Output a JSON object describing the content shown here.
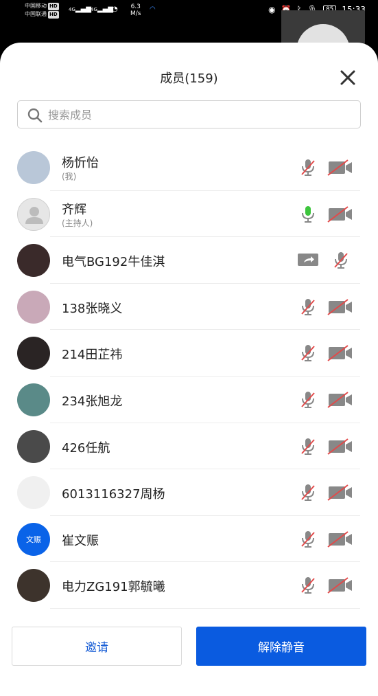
{
  "status_bar": {
    "carrier1": "中国移动",
    "carrier2": "中国联通",
    "hd": "HD",
    "net1": "4G",
    "net2": "4G",
    "speed_value": "6.3",
    "speed_unit": "M/s",
    "battery": "85",
    "time": "15:33"
  },
  "sheet": {
    "title": "成员(159)",
    "search_placeholder": "搜索成员"
  },
  "members": [
    {
      "name": "杨忻怡",
      "sub": "(我)",
      "avatar_color": "#b9c7d8",
      "mic_on": false,
      "screen_share": false
    },
    {
      "name": "齐辉",
      "sub": "(主持人)",
      "avatar_color": "#e6e6e6",
      "mic_on": true,
      "screen_share": false
    },
    {
      "name": "电气BG192牛佳淇",
      "sub": "",
      "avatar_color": "#3a2a2a",
      "mic_on": false,
      "screen_share": true
    },
    {
      "name": "138张晓义",
      "sub": "",
      "avatar_color": "#c9a9b8",
      "mic_on": false,
      "screen_share": false
    },
    {
      "name": "214田芷祎",
      "sub": "",
      "avatar_color": "#2a2424",
      "mic_on": false,
      "screen_share": false
    },
    {
      "name": "234张旭龙",
      "sub": "",
      "avatar_color": "#5a8a88",
      "mic_on": false,
      "screen_share": false
    },
    {
      "name": "426任航",
      "sub": "",
      "avatar_color": "#4a4a4a",
      "mic_on": false,
      "screen_share": false
    },
    {
      "name": "6013116327周杨",
      "sub": "",
      "avatar_color": "#f0f0f0",
      "mic_on": false,
      "screen_share": false
    },
    {
      "name": "崔文赈",
      "sub": "",
      "avatar_color": "#0a63e8",
      "avatar_text": "文赈",
      "mic_on": false,
      "screen_share": false
    },
    {
      "name": "电力ZG191郭毓曦",
      "sub": "",
      "avatar_color": "#3d332c",
      "mic_on": false,
      "screen_share": false
    }
  ],
  "buttons": {
    "invite": "邀请",
    "unmute_all": "解除静音"
  },
  "colors": {
    "accent": "#0a5be0",
    "mic_active": "#3dc53d",
    "muted_slash": "#e24a4a"
  }
}
